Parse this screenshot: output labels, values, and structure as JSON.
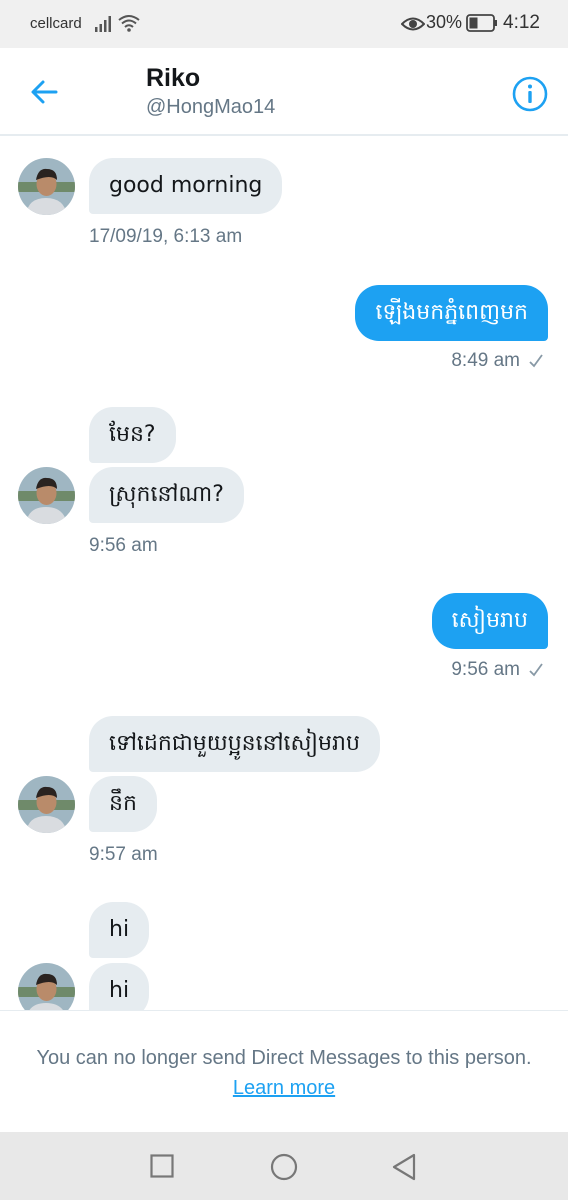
{
  "status_bar": {
    "carrier": "cellcard",
    "battery": "30%",
    "time": "4:12"
  },
  "header": {
    "name": "Riko",
    "handle": "@HongMao14"
  },
  "messages": [
    {
      "direction": "in",
      "text": "good morning"
    },
    {
      "direction": "in",
      "timestamp": "17/09/19, 6:13 am"
    },
    {
      "direction": "out",
      "text": "ឡើងមកភ្នំពេញមក"
    },
    {
      "direction": "out",
      "timestamp": "8:49 am"
    },
    {
      "direction": "in",
      "text": "មែន?"
    },
    {
      "direction": "in",
      "text": "ស្រុកនៅណា?"
    },
    {
      "direction": "in",
      "timestamp": "9:56 am"
    },
    {
      "direction": "out",
      "text": "សៀមរាប"
    },
    {
      "direction": "out",
      "timestamp": "9:56 am"
    },
    {
      "direction": "in",
      "text": "ទៅដេកជាមួយប្អូននៅសៀមរាប"
    },
    {
      "direction": "in",
      "text": "នឹក"
    },
    {
      "direction": "in",
      "timestamp": "9:57 am"
    },
    {
      "direction": "in",
      "text": "hi"
    },
    {
      "direction": "in",
      "text": "hi"
    }
  ],
  "footer": {
    "notice": "You can no longer send Direct Messages to this person.",
    "learn_more": "Learn more"
  },
  "colors": {
    "accent": "#1da1f2",
    "incoming_bubble": "#e6ecf0",
    "secondary_text": "#657786"
  },
  "icons": [
    "signal-icon",
    "wifi-icon",
    "eye-icon",
    "battery-icon",
    "back-arrow-icon",
    "info-icon",
    "read-check-icon",
    "nav-recents-icon",
    "nav-home-icon",
    "nav-back-icon"
  ]
}
